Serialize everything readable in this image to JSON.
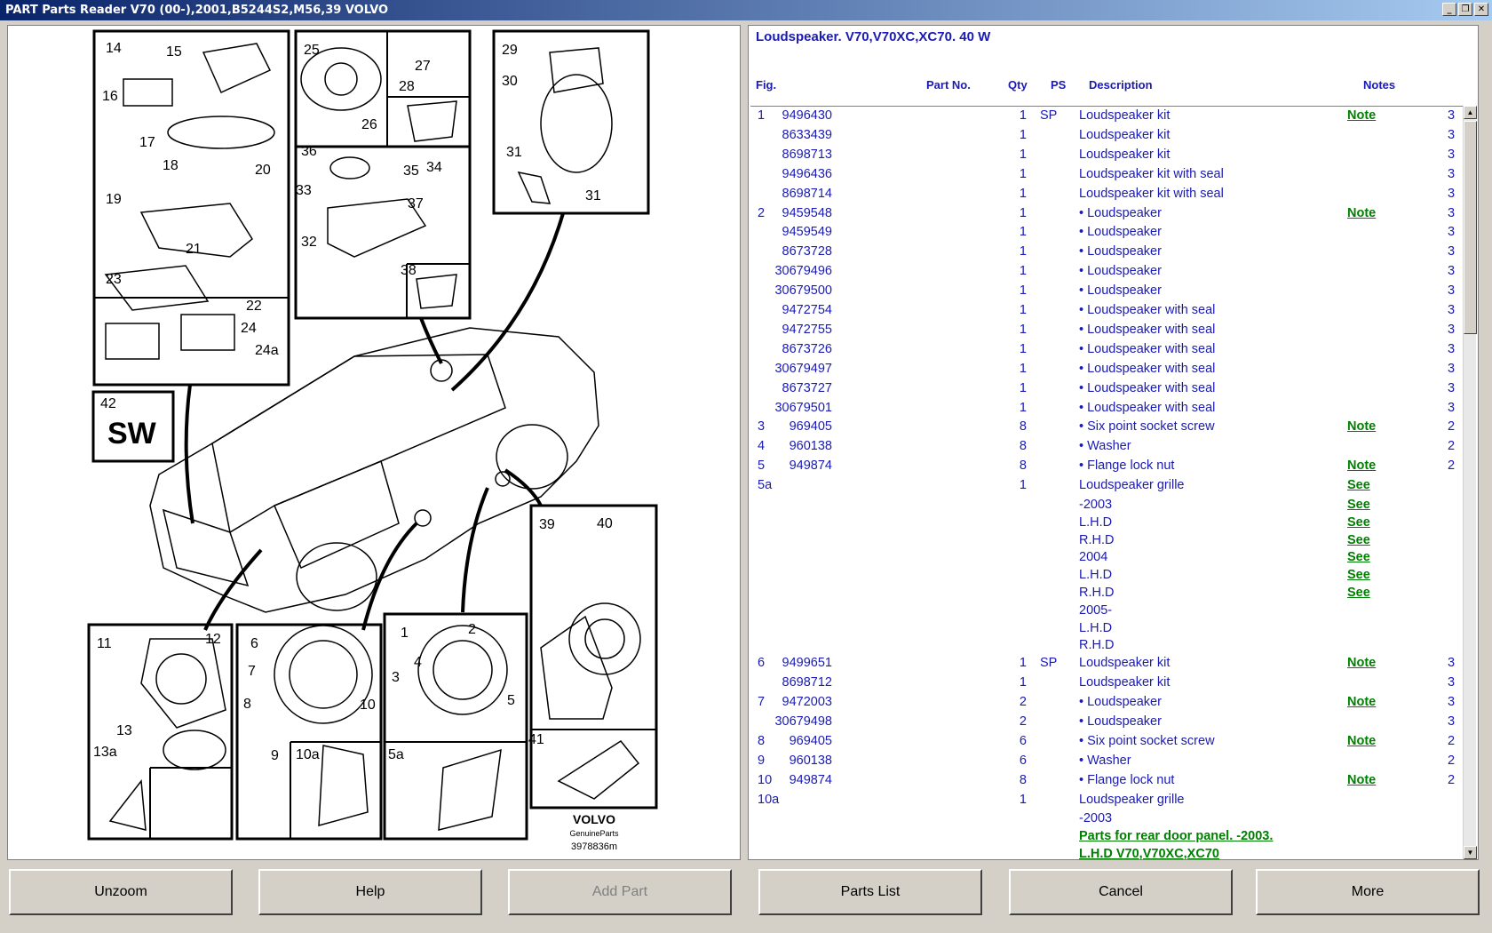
{
  "window": {
    "title": "PART Parts Reader V70 (00-),2001,B5244S2,M56,39 VOLVO",
    "minimize": "_",
    "restore": "❐",
    "close": "✕"
  },
  "diagram": {
    "brand": "VOLVO",
    "brand_sub": "GenuineParts",
    "drawing_number": "3978836m",
    "sw_label": "SW",
    "callouts": [
      "14",
      "15",
      "16",
      "17",
      "18",
      "19",
      "20",
      "21",
      "22",
      "23",
      "24",
      "24a",
      "25",
      "26",
      "27",
      "28",
      "29",
      "30",
      "31",
      "31",
      "32",
      "33",
      "34",
      "35",
      "36",
      "37",
      "38",
      "42",
      "11",
      "12",
      "13",
      "13a",
      "6",
      "7",
      "8",
      "9",
      "10",
      "10a",
      "1",
      "2",
      "3",
      "4",
      "5",
      "5a",
      "39",
      "40",
      "41"
    ]
  },
  "parts": {
    "title": "Loudspeaker. V70,V70XC,XC70. 40 W",
    "headers": {
      "fig": "Fig.",
      "part_no": "Part No.",
      "qty": "Qty",
      "ps": "PS",
      "description": "Description",
      "notes": "Notes"
    },
    "rows": [
      {
        "fig": "1",
        "part": "9496430",
        "qty": "1",
        "ps": "SP",
        "desc": "Loudspeaker kit",
        "note": "Note",
        "num": "3"
      },
      {
        "fig": "",
        "part": "8633439",
        "qty": "1",
        "ps": "",
        "desc": "Loudspeaker kit",
        "note": "",
        "num": "3"
      },
      {
        "fig": "",
        "part": "8698713",
        "qty": "1",
        "ps": "",
        "desc": "Loudspeaker kit",
        "note": "",
        "num": "3"
      },
      {
        "fig": "",
        "part": "9496436",
        "qty": "1",
        "ps": "",
        "desc": "Loudspeaker kit with seal",
        "note": "",
        "num": "3"
      },
      {
        "fig": "",
        "part": "8698714",
        "qty": "1",
        "ps": "",
        "desc": "Loudspeaker kit with seal",
        "note": "",
        "num": "3"
      },
      {
        "fig": "2",
        "part": "9459548",
        "qty": "1",
        "ps": "",
        "desc": "• Loudspeaker",
        "note": "Note",
        "num": "3"
      },
      {
        "fig": "",
        "part": "9459549",
        "qty": "1",
        "ps": "",
        "desc": "• Loudspeaker",
        "note": "",
        "num": "3"
      },
      {
        "fig": "",
        "part": "8673728",
        "qty": "1",
        "ps": "",
        "desc": "• Loudspeaker",
        "note": "",
        "num": "3"
      },
      {
        "fig": "",
        "part": "30679496",
        "qty": "1",
        "ps": "",
        "desc": "• Loudspeaker",
        "note": "",
        "num": "3"
      },
      {
        "fig": "",
        "part": "30679500",
        "qty": "1",
        "ps": "",
        "desc": "• Loudspeaker",
        "note": "",
        "num": "3"
      },
      {
        "fig": "",
        "part": "9472754",
        "qty": "1",
        "ps": "",
        "desc": "• Loudspeaker with seal",
        "note": "",
        "num": "3"
      },
      {
        "fig": "",
        "part": "9472755",
        "qty": "1",
        "ps": "",
        "desc": "• Loudspeaker with seal",
        "note": "",
        "num": "3"
      },
      {
        "fig": "",
        "part": "8673726",
        "qty": "1",
        "ps": "",
        "desc": "• Loudspeaker with seal",
        "note": "",
        "num": "3"
      },
      {
        "fig": "",
        "part": "30679497",
        "qty": "1",
        "ps": "",
        "desc": "• Loudspeaker with seal",
        "note": "",
        "num": "3"
      },
      {
        "fig": "",
        "part": "8673727",
        "qty": "1",
        "ps": "",
        "desc": "• Loudspeaker with seal",
        "note": "",
        "num": "3"
      },
      {
        "fig": "",
        "part": "30679501",
        "qty": "1",
        "ps": "",
        "desc": "• Loudspeaker with seal",
        "note": "",
        "num": "3"
      },
      {
        "fig": "3",
        "part": "969405",
        "qty": "8",
        "ps": "",
        "desc": "• Six point socket screw",
        "note": "Note",
        "num": "2"
      },
      {
        "fig": "4",
        "part": "960138",
        "qty": "8",
        "ps": "",
        "desc": "• Washer",
        "note": "",
        "num": "2"
      },
      {
        "fig": "5",
        "part": "949874",
        "qty": "8",
        "ps": "",
        "desc": "• Flange lock nut",
        "note": "Note",
        "num": "2"
      },
      {
        "fig": "5a",
        "part": "",
        "qty": "1",
        "ps": "",
        "desc": "Loudspeaker grille",
        "note": "See",
        "num": ""
      },
      {
        "fig": "",
        "part": "",
        "qty": "",
        "ps": "",
        "desc": "-2003",
        "note": "See",
        "num": ""
      },
      {
        "fig": "",
        "part": "",
        "qty": "",
        "ps": "",
        "desc": "L.H.D",
        "note": "See",
        "num": ""
      },
      {
        "fig": "",
        "part": "",
        "qty": "",
        "ps": "",
        "desc": "R.H.D",
        "note": "See",
        "num": ""
      },
      {
        "fig": "",
        "part": "",
        "qty": "",
        "ps": "",
        "desc": "2004",
        "note": "See",
        "num": ""
      },
      {
        "fig": "",
        "part": "",
        "qty": "",
        "ps": "",
        "desc": "L.H.D",
        "note": "See",
        "num": ""
      },
      {
        "fig": "",
        "part": "",
        "qty": "",
        "ps": "",
        "desc": "R.H.D",
        "note": "See",
        "num": ""
      },
      {
        "fig": "",
        "part": "",
        "qty": "",
        "ps": "",
        "desc": "2005-",
        "note": "",
        "num": ""
      },
      {
        "fig": "",
        "part": "",
        "qty": "",
        "ps": "",
        "desc": "L.H.D",
        "note": "",
        "num": ""
      },
      {
        "fig": "",
        "part": "",
        "qty": "",
        "ps": "",
        "desc": "R.H.D",
        "note": "",
        "num": ""
      },
      {
        "fig": "6",
        "part": "9499651",
        "qty": "1",
        "ps": "SP",
        "desc": "Loudspeaker kit",
        "note": "Note",
        "num": "3"
      },
      {
        "fig": "",
        "part": "8698712",
        "qty": "1",
        "ps": "",
        "desc": "Loudspeaker kit",
        "note": "",
        "num": "3"
      },
      {
        "fig": "7",
        "part": "9472003",
        "qty": "2",
        "ps": "",
        "desc": "• Loudspeaker",
        "note": "Note",
        "num": "3"
      },
      {
        "fig": "",
        "part": "30679498",
        "qty": "2",
        "ps": "",
        "desc": "• Loudspeaker",
        "note": "",
        "num": "3"
      },
      {
        "fig": "8",
        "part": "969405",
        "qty": "6",
        "ps": "",
        "desc": "• Six point socket screw",
        "note": "Note",
        "num": "2"
      },
      {
        "fig": "9",
        "part": "960138",
        "qty": "6",
        "ps": "",
        "desc": "• Washer",
        "note": "",
        "num": "2"
      },
      {
        "fig": "10",
        "part": "949874",
        "qty": "8",
        "ps": "",
        "desc": "• Flange lock nut",
        "note": "Note",
        "num": "2"
      },
      {
        "fig": "10a",
        "part": "",
        "qty": "1",
        "ps": "",
        "desc": "Loudspeaker grille",
        "note": "",
        "num": ""
      },
      {
        "fig": "",
        "part": "",
        "qty": "",
        "ps": "",
        "desc": "-2003",
        "note": "",
        "num": ""
      }
    ],
    "link_rows": [
      "Parts for rear door panel. -2003.",
      "L.H.D V70,V70XC,XC70"
    ]
  },
  "buttons": {
    "unzoom": "Unzoom",
    "help": "Help",
    "add_part": "Add Part",
    "parts_list": "Parts List",
    "cancel": "Cancel",
    "more": "More"
  }
}
